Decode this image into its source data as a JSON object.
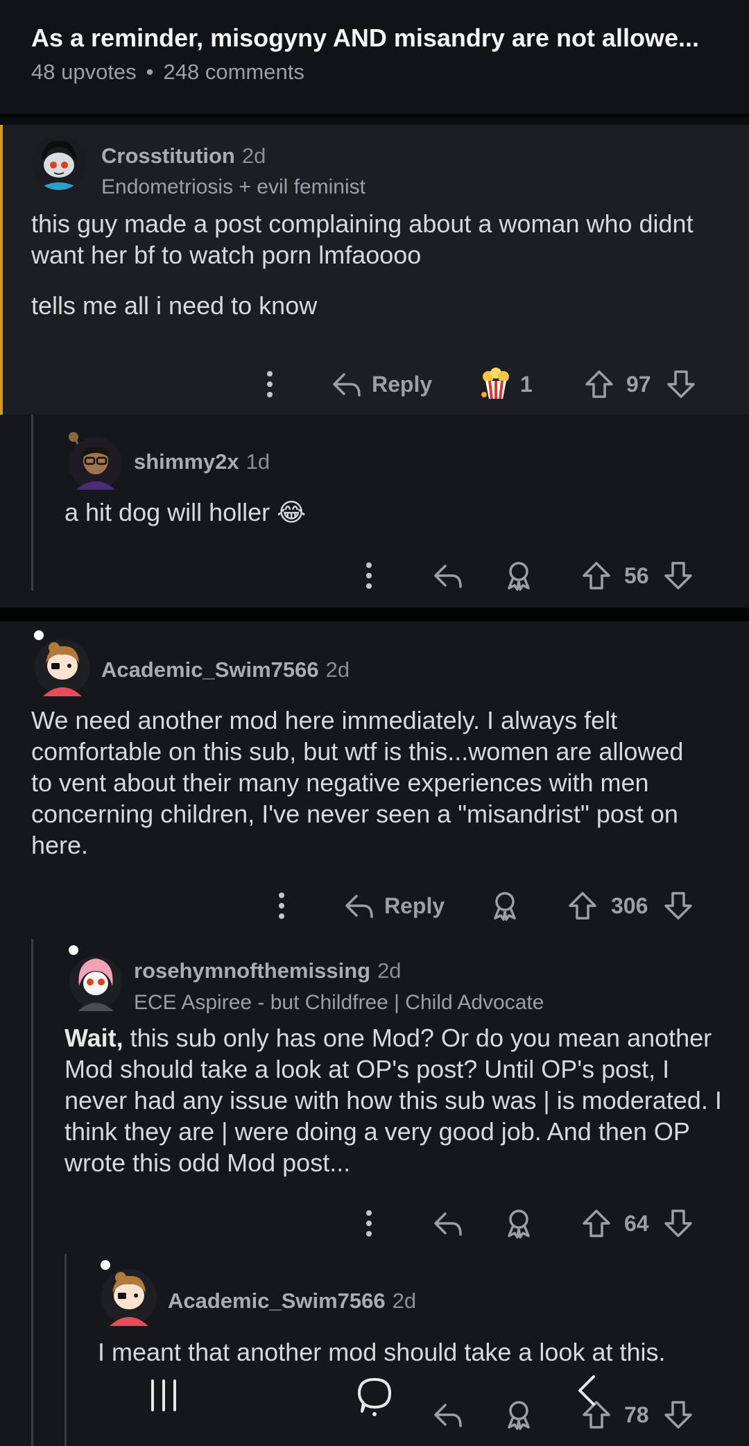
{
  "post": {
    "title": "As a reminder, misogyny AND misandry are not allowe...",
    "upvotes": "48 upvotes",
    "comments": "248 comments",
    "separator": "•"
  },
  "comments": [
    {
      "username": "Crosstitution",
      "age": "2d",
      "flair": "Endometriosis + evil feminist",
      "body_p1": "this guy made a post complaining about a woman who didnt want her bf to watch porn lmfaoooo",
      "body_p2": "tells me all i need to know",
      "reply_label": "Reply",
      "award_count": "1",
      "votes": "97"
    },
    {
      "username": "shimmy2x",
      "age": "1d",
      "body": "a hit dog will holler 😂",
      "votes": "56"
    },
    {
      "username": "Academic_Swim7566",
      "age": "2d",
      "body": "We need another mod here immediately. I always felt comfortable on this sub, but wtf is this...women are allowed to vent about their many negative experiences with men concerning children, I've never seen a \"misandrist\" post on here.",
      "reply_label": "Reply",
      "votes": "306"
    },
    {
      "username": "rosehymnofthemissing",
      "age": "2d",
      "flair": "ECE Aspiree - but Childfree | Child Advocate",
      "body_bold": "Wait,",
      "body": " this sub only has one Mod? Or do you mean another Mod should take a look at OP's post? Until OP's post, I never had any issue with how this sub was | is moderated. I think they are | were doing a very good job. And then OP wrote this odd Mod post...",
      "votes": "64"
    },
    {
      "username": "Academic_Swim7566",
      "age": "2d",
      "body": "I meant that another mod should take a look at this.",
      "votes": "78"
    }
  ],
  "icons": {
    "more": "more-vertical-icon",
    "reply": "reply-arrow-icon",
    "award": "award-icon",
    "upvote": "upvote-arrow-icon",
    "downvote": "downvote-arrow-icon"
  },
  "colors": {
    "highlight_border": "#d39b1f",
    "background": "#0b0c0e",
    "text": "#d7dadc"
  }
}
